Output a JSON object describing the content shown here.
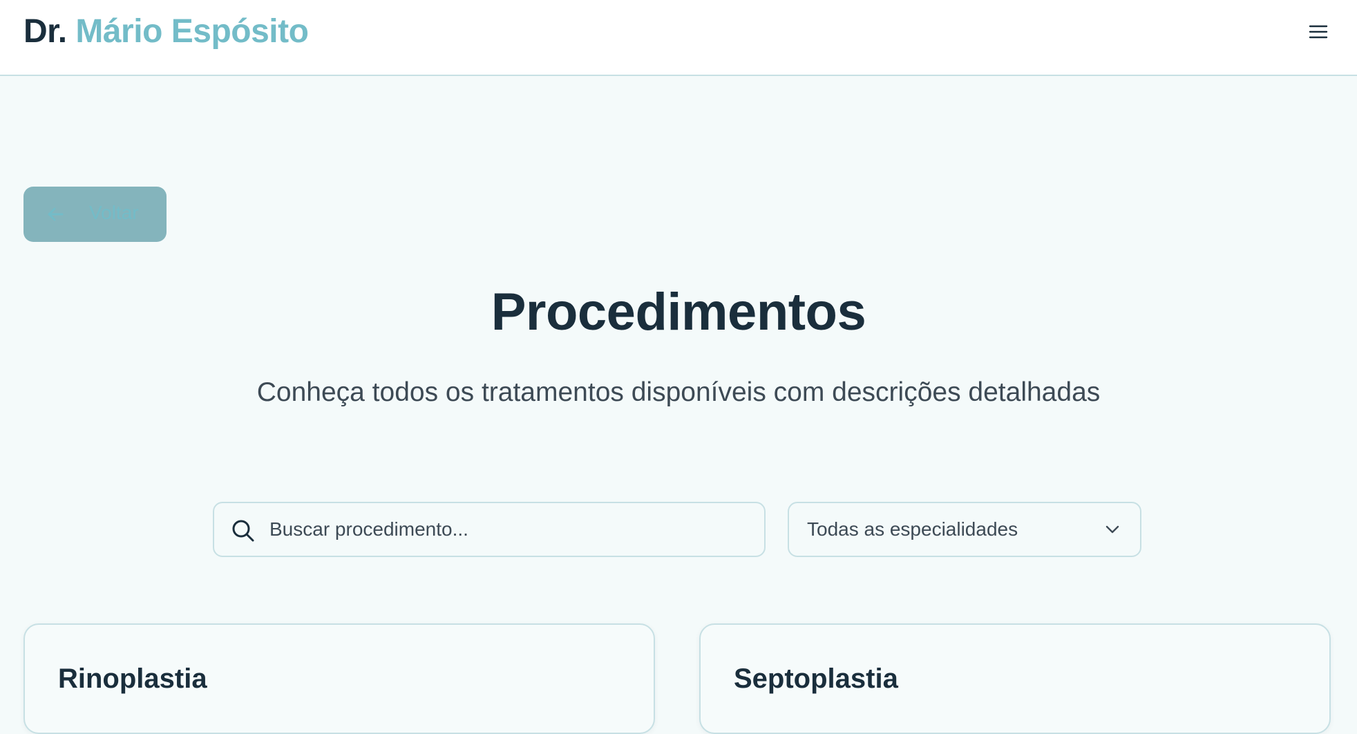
{
  "header": {
    "brand_prefix": "Dr.",
    "brand_name": "Mário Espósito",
    "menu_icon": "hamburger-menu-icon"
  },
  "back_button": {
    "label": "Voltar",
    "icon": "arrow-left-icon"
  },
  "hero": {
    "title": "Procedimentos",
    "subtitle": "Conheça todos os tratamentos disponíveis com descrições detalhadas"
  },
  "filters": {
    "search": {
      "placeholder": "Buscar procedimento...",
      "value": "",
      "icon": "search-icon"
    },
    "specialty": {
      "selected": "Todas as especialidades",
      "icon": "chevron-down-icon"
    }
  },
  "procedures": [
    {
      "title": "Rinoplastia"
    },
    {
      "title": "Septoplastia"
    }
  ],
  "colors": {
    "background": "#f4fafa",
    "header_bg": "#ffffff",
    "text_dark": "#1a2e3c",
    "accent": "#73bcc8",
    "back_button_bg": "#84b4bc",
    "border": "#c7e0e4"
  }
}
